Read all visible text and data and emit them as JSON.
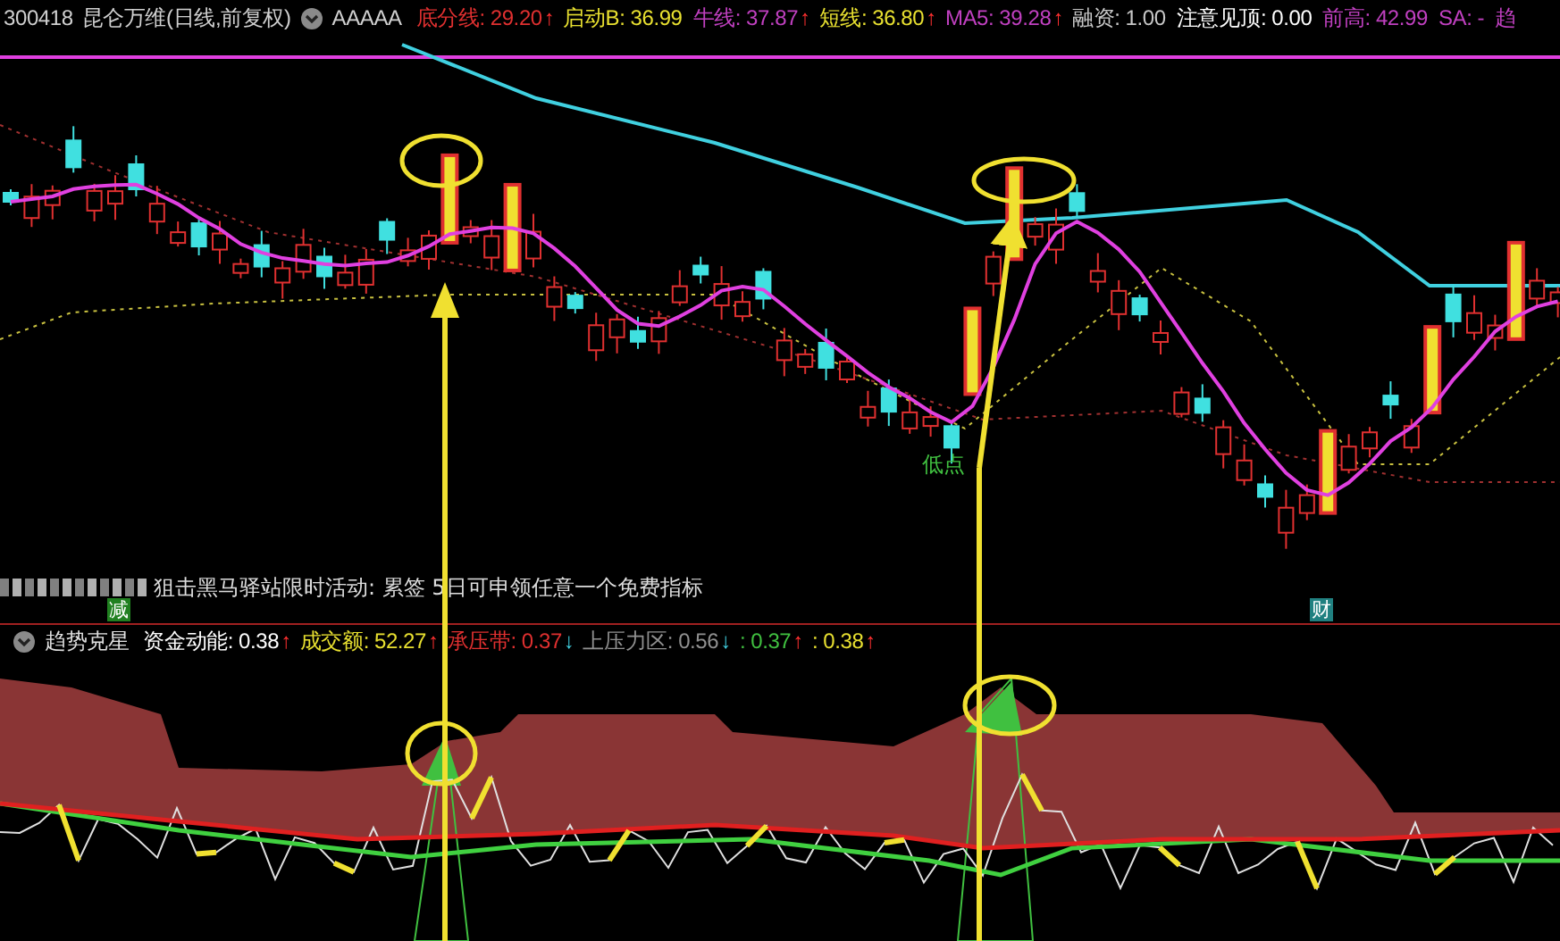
{
  "top_bar": {
    "code": "300418",
    "name": "昆仑万维(日线,前复权)",
    "indicator": "AAAAA",
    "items": [
      {
        "label": "底分线:",
        "value": "29.20",
        "rising": true,
        "arrow": "↑",
        "color": "#e03030"
      },
      {
        "label": "启动B:",
        "value": "36.99",
        "color": "#e8e030"
      },
      {
        "label": "牛线:",
        "value": "37.87",
        "rising": true,
        "arrow": "↑",
        "color": "#c040c0"
      },
      {
        "label": "短线:",
        "value": "36.80",
        "rising": true,
        "arrow": "↑",
        "color": "#e8e030"
      },
      {
        "label": "MA5:",
        "value": "39.28",
        "rising": true,
        "arrow": "↑",
        "color": "#c040c0"
      },
      {
        "label": "融资:",
        "value": "1.00",
        "color": "#c8c8c8"
      },
      {
        "label": "注意见顶:",
        "value": "0.00",
        "color": "#ffffff"
      },
      {
        "label": "前高:",
        "value": "42.99",
        "color": "#c040c0"
      },
      {
        "label": "SA:",
        "value": "-",
        "color": "#c040c0"
      },
      {
        "label": "趋",
        "color": "#c040c0"
      }
    ]
  },
  "price_chart": {
    "low_point_label": "低点"
  },
  "ticker": {
    "text": "狙击黑马驿站限时活动: 累签 5日可申领任意一个免费指标",
    "badges": [
      {
        "text": "减",
        "color": "#208020"
      },
      {
        "text": "财",
        "color": "#208080"
      }
    ]
  },
  "indicator_bar": {
    "title": "趋势克星",
    "items": [
      {
        "label": "资金动能:",
        "value": "0.38",
        "rising": true,
        "arrow": "↑",
        "color": "#ffffff"
      },
      {
        "label": "成交额:",
        "value": "52.27",
        "rising": true,
        "arrow": "↑",
        "color": "#e8e030"
      },
      {
        "label": "承压带:",
        "value": "0.37",
        "rising": false,
        "arrow": "↓",
        "color": "#e03030"
      },
      {
        "label": "上压力区:",
        "value": "0.56",
        "rising": false,
        "arrow": "↓",
        "color": "#909090"
      },
      {
        "label": ":",
        "value": "0.37",
        "rising": true,
        "arrow": "↑",
        "color": "#40c040"
      },
      {
        "label": ":",
        "value": "0.38",
        "rising": true,
        "arrow": "↑",
        "color": "#e8e030"
      }
    ]
  }
}
